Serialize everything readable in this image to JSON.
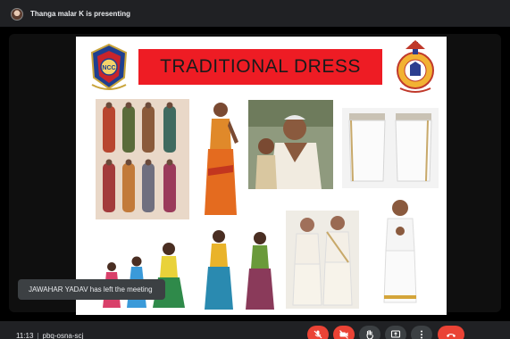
{
  "presenter_bar": {
    "text": "Thanga malar K is presenting"
  },
  "slide": {
    "title": "TRADITIONAL DRESS",
    "emblem_left_text": "NCC"
  },
  "toast": {
    "text": "JAWAHAR YADAV has left the meeting"
  },
  "meeting": {
    "time": "11:13",
    "separator": "|",
    "code": "pbq-osna-scj"
  },
  "controls": [
    {
      "name": "mic-off",
      "state": "off"
    },
    {
      "name": "camera-off",
      "state": "off"
    },
    {
      "name": "raise-hand",
      "state": "normal"
    },
    {
      "name": "present",
      "state": "normal"
    },
    {
      "name": "more-options",
      "state": "normal"
    },
    {
      "name": "leave-call",
      "state": "danger"
    }
  ],
  "colors": {
    "banner_red": "#ee1c24",
    "control_red": "#ea4335",
    "control_grey": "#3c4043",
    "bar_bg": "#202124"
  }
}
